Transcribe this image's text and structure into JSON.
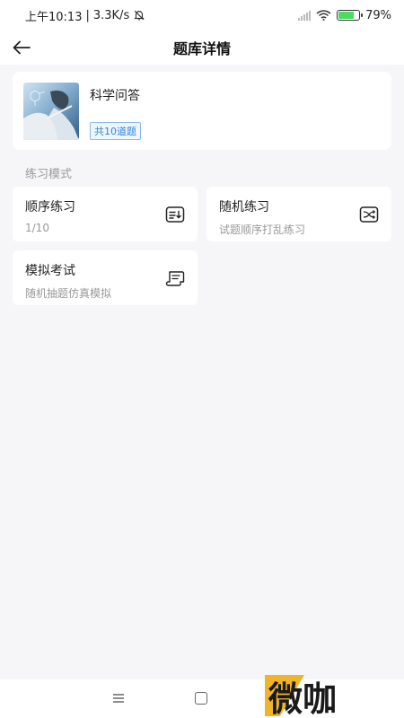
{
  "status": {
    "time": "上午10:13",
    "separator": "|",
    "speed": "3.3K/s",
    "battery": "79%",
    "battery_level": 0.79
  },
  "header": {
    "title": "题库详情"
  },
  "bank": {
    "name": "科学问答",
    "count": "共10道题"
  },
  "section": {
    "label": "练习模式"
  },
  "modes": [
    {
      "title": "顺序练习",
      "desc": "1/10",
      "icon": "list-sequence-icon"
    },
    {
      "title": "随机练习",
      "desc": "试题顺序打乱练习",
      "icon": "shuffle-icon"
    },
    {
      "title": "模拟考试",
      "desc": "随机抽题仿真模拟",
      "icon": "exam-scroll-icon"
    }
  ],
  "watermark": {
    "text": "微咖"
  },
  "colors": {
    "accent": "#2e86de",
    "background": "#f6f6f8",
    "watermark_mark": "#f0b429"
  }
}
